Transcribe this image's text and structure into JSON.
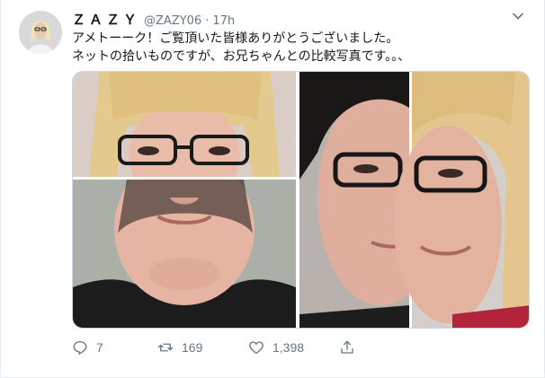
{
  "tweet": {
    "display_name": "ＺＡＺＹ",
    "handle": "@ZAZY06",
    "separator": "·",
    "time": "17h",
    "text_lines": [
      "アメトーーク！ご覧頂いた皆様ありがとうございました。",
      "ネットの拾いものですが、お兄ちゃんとの比較写真です。。、"
    ]
  },
  "actions": {
    "replies": "7",
    "retweets": "169",
    "likes": "1,398"
  },
  "colors": {
    "secondary_text": "#657786",
    "border": "#e6ecf0"
  },
  "icons": [
    "chevron-down-icon",
    "reply-icon",
    "retweet-icon",
    "heart-icon",
    "share-icon"
  ]
}
